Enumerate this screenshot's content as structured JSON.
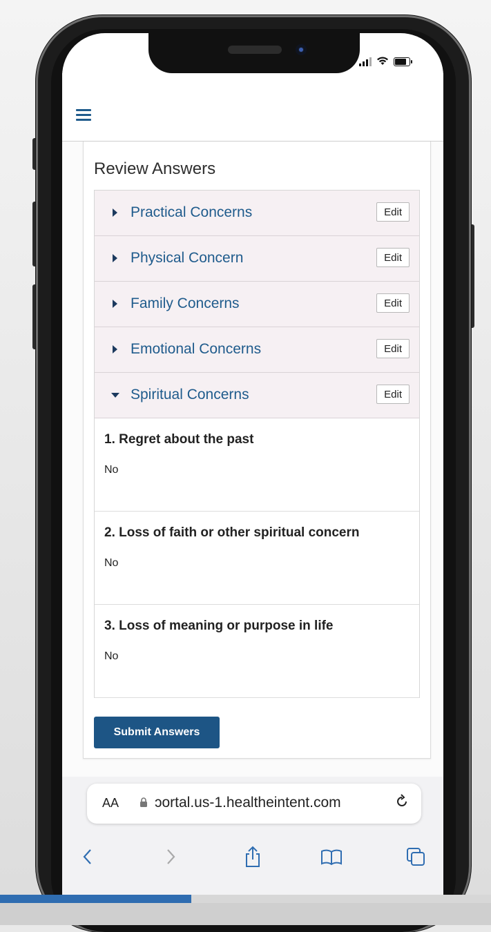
{
  "app": {
    "menu_icon": "hamburger-menu-icon"
  },
  "review": {
    "title": "Review Answers",
    "sections": [
      {
        "label": "Practical Concerns",
        "expanded": false,
        "edit_label": "Edit"
      },
      {
        "label": "Physical Concern",
        "expanded": false,
        "edit_label": "Edit"
      },
      {
        "label": "Family Concerns",
        "expanded": false,
        "edit_label": "Edit"
      },
      {
        "label": "Emotional Concerns",
        "expanded": false,
        "edit_label": "Edit"
      },
      {
        "label": "Spiritual Concerns",
        "expanded": true,
        "edit_label": "Edit"
      }
    ],
    "questions": [
      {
        "question": "1. Regret about the past",
        "answer": "No"
      },
      {
        "question": "2. Loss of faith or other spiritual concern",
        "answer": "No"
      },
      {
        "question": "3. Loss of meaning or purpose in life",
        "answer": "No"
      }
    ],
    "submit_label": "Submit Answers"
  },
  "browser": {
    "text_size_label": "AA",
    "url": "ɔortal.us-1.healtheintent.com",
    "lock_icon": "lock-icon",
    "reload_icon": "reload-icon",
    "nav_icons": [
      "back-icon",
      "forward-icon",
      "share-icon",
      "bookmarks-icon",
      "tabs-icon"
    ]
  },
  "colors": {
    "accent": "#1f5b8c",
    "submit_bg": "#1d5585",
    "accordion_bg": "#f6f0f3",
    "progress": "#2f6db1"
  },
  "video_progress": 0.39
}
